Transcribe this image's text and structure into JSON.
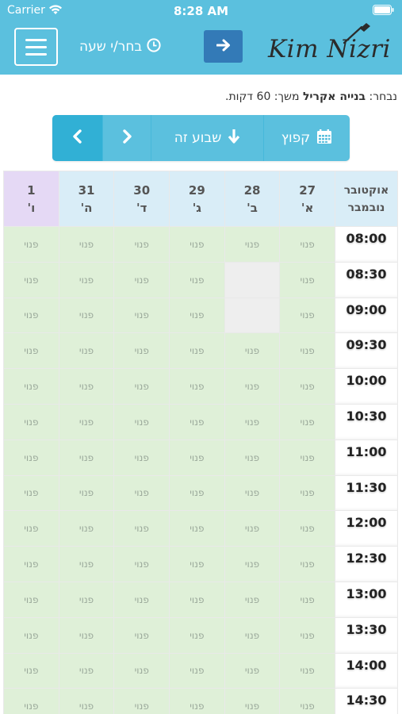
{
  "status_bar": {
    "carrier": "Carrier",
    "time": "8:28 AM",
    "wifi_icon": "wifi-icon",
    "battery_icon": "battery-icon"
  },
  "header": {
    "menu_icon": "hamburger-menu-icon",
    "choose_time_label": "בחר/י שעה",
    "choose_time_icon": "clock-icon",
    "next_icon": "arrow-right-icon",
    "logo_text": "Kim Nizri",
    "bg_color": "#5bc0de",
    "button_color": "#337ab7"
  },
  "selection": {
    "prefix": "נבחר:",
    "service": "בנייה אקריל",
    "duration": "משך: 60 דקות."
  },
  "nav": {
    "next_week_icon": "chevron-right-icon",
    "prev_week_icon": "chevron-left-icon",
    "this_week_label": "שבוע זה",
    "this_week_icon": "arrow-down-icon",
    "jump_label": "קפוץ",
    "jump_icon": "calendar-icon"
  },
  "calendar": {
    "month_header": [
      "אוקטובר",
      "נובמבר"
    ],
    "days": [
      {
        "date": "27",
        "weekday": "א'"
      },
      {
        "date": "28",
        "weekday": "ב'"
      },
      {
        "date": "29",
        "weekday": "ג'"
      },
      {
        "date": "30",
        "weekday": "ד'"
      },
      {
        "date": "31",
        "weekday": "ה'"
      },
      {
        "date": "1",
        "weekday": "ו'"
      }
    ],
    "free_label": "פנוי",
    "free_color": "#dff0d8",
    "busy_color": "#eeeeee",
    "header_color": "#d9edf7",
    "friday_header_color": "#e5d9f5",
    "rows": [
      {
        "time": "08:00",
        "slots": [
          "פנוי",
          "פנוי",
          "פנוי",
          "פנוי",
          "פנוי",
          "פנוי"
        ]
      },
      {
        "time": "08:30",
        "slots": [
          "פנוי",
          "",
          "פנוי",
          "פנוי",
          "פנוי",
          "פנוי"
        ]
      },
      {
        "time": "09:00",
        "slots": [
          "פנוי",
          "",
          "פנוי",
          "פנוי",
          "פנוי",
          "פנוי"
        ]
      },
      {
        "time": "09:30",
        "slots": [
          "פנוי",
          "פנוי",
          "פנוי",
          "פנוי",
          "פנוי",
          "פנוי"
        ]
      },
      {
        "time": "10:00",
        "slots": [
          "פנוי",
          "פנוי",
          "פנוי",
          "פנוי",
          "פנוי",
          "פנוי"
        ]
      },
      {
        "time": "10:30",
        "slots": [
          "פנוי",
          "פנוי",
          "פנוי",
          "פנוי",
          "פנוי",
          "פנוי"
        ]
      },
      {
        "time": "11:00",
        "slots": [
          "פנוי",
          "פנוי",
          "פנוי",
          "פנוי",
          "פנוי",
          "פנוי"
        ]
      },
      {
        "time": "11:30",
        "slots": [
          "פנוי",
          "פנוי",
          "פנוי",
          "פנוי",
          "פנוי",
          "פנוי"
        ]
      },
      {
        "time": "12:00",
        "slots": [
          "פנוי",
          "פנוי",
          "פנוי",
          "פנוי",
          "פנוי",
          "פנוי"
        ]
      },
      {
        "time": "12:30",
        "slots": [
          "פנוי",
          "פנוי",
          "פנוי",
          "פנוי",
          "פנוי",
          "פנוי"
        ]
      },
      {
        "time": "13:00",
        "slots": [
          "פנוי",
          "פנוי",
          "פנוי",
          "פנוי",
          "פנוי",
          "פנוי"
        ]
      },
      {
        "time": "13:30",
        "slots": [
          "פנוי",
          "פנוי",
          "פנוי",
          "פנוי",
          "פנוי",
          "פנוי"
        ]
      },
      {
        "time": "14:00",
        "slots": [
          "פנוי",
          "פנוי",
          "פנוי",
          "פנוי",
          "פנוי",
          "פנוי"
        ]
      },
      {
        "time": "14:30",
        "slots": [
          "פנוי",
          "פנוי",
          "פנוי",
          "פנוי",
          "פנוי",
          "פנוי"
        ]
      }
    ]
  }
}
